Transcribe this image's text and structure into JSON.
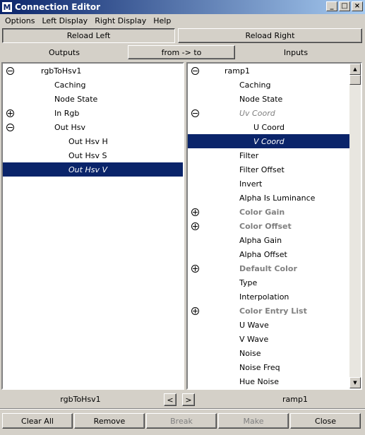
{
  "window": {
    "title": "Connection Editor",
    "icon": "maya-icon",
    "controls": {
      "minimize": "_",
      "maximize": "□",
      "close": "×"
    }
  },
  "menu": [
    "Options",
    "Left Display",
    "Right Display",
    "Help"
  ],
  "toolbar": {
    "reload_left": "Reload Left",
    "reload_right": "Reload Right",
    "outputs_label": "Outputs",
    "direction_button": "from -> to",
    "inputs_label": "Inputs"
  },
  "left_panel": {
    "rows": [
      {
        "label": "rgbToHsv1",
        "expander": "minus",
        "indent": 1
      },
      {
        "label": "Caching",
        "indent": 2
      },
      {
        "label": "Node State",
        "indent": 2
      },
      {
        "label": "In Rgb",
        "expander": "plus",
        "indent": 2
      },
      {
        "label": "Out Hsv",
        "expander": "minus",
        "indent": 2
      },
      {
        "label": "Out Hsv H",
        "indent": 3
      },
      {
        "label": "Out Hsv S",
        "indent": 3
      },
      {
        "label": "Out Hsv V",
        "indent": 3,
        "selected": true
      }
    ],
    "node_name": "rgbToHsv1"
  },
  "right_panel": {
    "rows": [
      {
        "label": "ramp1",
        "expander": "minus",
        "indent": 1
      },
      {
        "label": "Caching",
        "indent": 2
      },
      {
        "label": "Node State",
        "indent": 2
      },
      {
        "label": "Uv Coord",
        "expander": "minus",
        "indent": 2,
        "greyed": true,
        "italic": true
      },
      {
        "label": "U Coord",
        "indent": 3
      },
      {
        "label": "V Coord",
        "indent": 3,
        "selected": true
      },
      {
        "label": "Filter",
        "indent": 2
      },
      {
        "label": "Filter Offset",
        "indent": 2
      },
      {
        "label": "Invert",
        "indent": 2
      },
      {
        "label": "Alpha Is Luminance",
        "indent": 2
      },
      {
        "label": "Color Gain",
        "expander": "plus",
        "indent": 2,
        "greyed": true
      },
      {
        "label": "Color Offset",
        "expander": "plus",
        "indent": 2,
        "greyed": true
      },
      {
        "label": "Alpha Gain",
        "indent": 2
      },
      {
        "label": "Alpha Offset",
        "indent": 2
      },
      {
        "label": "Default Color",
        "expander": "plus",
        "indent": 2,
        "greyed": true
      },
      {
        "label": "Type",
        "indent": 2
      },
      {
        "label": "Interpolation",
        "indent": 2
      },
      {
        "label": "Color Entry List",
        "expander": "plus",
        "indent": 2,
        "greyed": true
      },
      {
        "label": "U Wave",
        "indent": 2
      },
      {
        "label": "V Wave",
        "indent": 2
      },
      {
        "label": "Noise",
        "indent": 2
      },
      {
        "label": "Noise Freq",
        "indent": 2
      },
      {
        "label": "Hue Noise",
        "indent": 2
      }
    ],
    "node_name": "ramp1"
  },
  "nav": {
    "prev": "<",
    "next": ">"
  },
  "footer": {
    "clear_all": "Clear All",
    "remove": "Remove",
    "break": "Break",
    "make": "Make",
    "close": "Close"
  }
}
